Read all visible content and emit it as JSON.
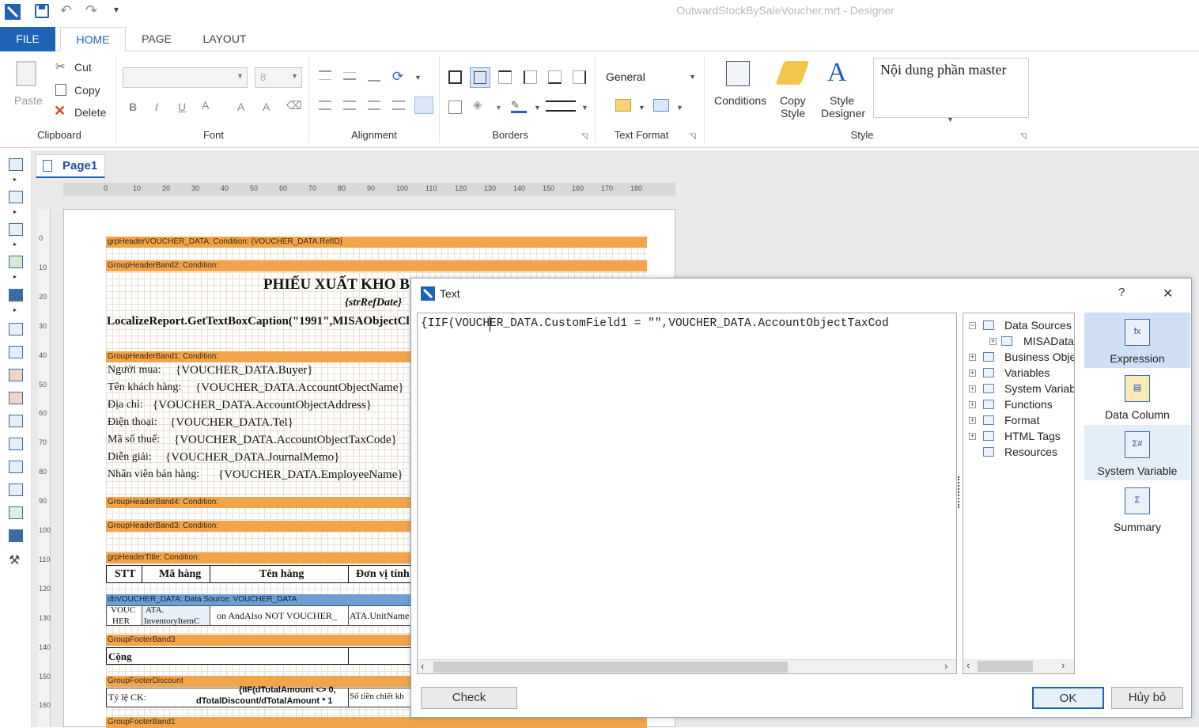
{
  "window": {
    "title": "OutwardStockBySaleVoucher.mrt  - Designer"
  },
  "quick_access": {
    "save": "save-icon",
    "undo": "undo-icon",
    "redo": "redo-icon",
    "customize": "▾"
  },
  "ribbon_tabs": [
    "FILE",
    "HOME",
    "PAGE",
    "LAYOUT"
  ],
  "clipboard": {
    "paste": "Paste",
    "cut": "Cut",
    "copy": "Copy",
    "delete": "Delete",
    "label": "Clipboard"
  },
  "font": {
    "name": "",
    "size": "8",
    "bold": "B",
    "italic": "I",
    "underline": "U",
    "color": "A",
    "grow": "A",
    "shrink": "A",
    "label": "Font"
  },
  "alignment": {
    "label": "Alignment"
  },
  "borders": {
    "label": "Borders"
  },
  "text_format": {
    "value": "General",
    "label": "Text Format"
  },
  "style": {
    "conditions": "Conditions",
    "copy_style": [
      "Copy",
      "Style"
    ],
    "designer": [
      "Style",
      "Designer"
    ],
    "preview": "Nội dung phần master",
    "label": "Style"
  },
  "designer": {
    "page_tab": "Page1",
    "ruler_h": [
      "0",
      "10",
      "20",
      "30",
      "40",
      "50",
      "60",
      "70",
      "80",
      "90",
      "100",
      "110",
      "120",
      "130",
      "140",
      "150",
      "160",
      "170",
      "180"
    ],
    "ruler_v": [
      "0",
      "10",
      "20",
      "30",
      "40",
      "50",
      "60",
      "70",
      "80",
      "90",
      "100",
      "110",
      "120",
      "130",
      "140",
      "150",
      "160"
    ]
  },
  "report": {
    "bands": [
      "grpHeaderVOUCHER_DATA: Condition: {VOUCHER_DATA.RefID}",
      "GroupHeaderBand2: Condition:",
      "GroupHeaderBand1: Condition:",
      "GroupHeaderBand4: Condition:",
      "GroupHeaderBand3: Condition:",
      "grpHeaderTitle: Condition:",
      "dbVOUCHER_DATA: Data Source: VOUCHER_DATA",
      "GroupFooterBand3",
      "GroupFooterDiscount",
      "GroupFooterBand1"
    ],
    "title": "PHIẾU XUẤT KHO B",
    "date_expr": "{strRefDate}",
    "caption_expr": "LocalizeReport.GetTextBoxCaption(\"1991\",MISAObjectCl",
    "fields": [
      {
        "label": "Người mua:",
        "value": "{VOUCHER_DATA.Buyer}"
      },
      {
        "label": "Tên khách hàng:",
        "value": "{VOUCHER_DATA.AccountObjectName}"
      },
      {
        "label": "Địa chỉ:",
        "value": "{VOUCHER_DATA.AccountObjectAddress}"
      },
      {
        "label": "Điện thoại:",
        "value": "{VOUCHER_DATA.Tel}"
      },
      {
        "label": "Mã số thuế:",
        "value": "{VOUCHER_DATA.AccountObjectTaxCode}"
      },
      {
        "label": "Diễn giải:",
        "value": "{VOUCHER_DATA.JournalMemo}"
      },
      {
        "label": "Nhân viên bán hàng:",
        "value": "{VOUCHER_DATA.EmployeeName}"
      }
    ],
    "table_headers": [
      "STT",
      "Mã hàng",
      "Tên hàng",
      "Đơn vị tính"
    ],
    "data_cells": [
      "VOUC",
      "HER",
      "ATA.",
      "InventoryItemC",
      "on AndAlso NOT VOUCHER_",
      "ATA.UnitName"
    ],
    "footer_total": "Cộng",
    "discount_label": "Tỷ lệ CK:",
    "discount_expr": "{IIF(dTotalAmount <> 0,",
    "discount_expr2": "dTotalDiscount/dTotalAmount * 1",
    "discount_amount_label": "Số tiền chiết kh"
  },
  "dialog": {
    "title": "Text",
    "help": "?",
    "close": "✕",
    "expression": "{IIF(VOUCHER_DATA.CustomField1 = \"\",VOUCHER_DATA.AccountObjectTaxCod",
    "tree": [
      {
        "label": "Data Sources",
        "expander": "−",
        "icon": "data-sources-icon"
      },
      {
        "label": "MISAData",
        "expander": "+",
        "icon": "database-icon"
      },
      {
        "label": "Business Objec",
        "expander": "+",
        "icon": "business-objects-icon"
      },
      {
        "label": "Variables",
        "expander": "+",
        "icon": "variables-icon"
      },
      {
        "label": "System Variabl",
        "expander": "+",
        "icon": "system-variables-icon"
      },
      {
        "label": "Functions",
        "expander": "+",
        "icon": "functions-icon"
      },
      {
        "label": "Format",
        "expander": "+",
        "icon": "format-icon"
      },
      {
        "label": "HTML Tags",
        "expander": "+",
        "icon": "html-tags-icon"
      },
      {
        "label": "Resources",
        "expander": "",
        "icon": "resources-icon"
      }
    ],
    "side_buttons": [
      "Expression",
      "Data Column",
      "System Variable",
      "Summary"
    ],
    "check": "Check",
    "ok": "OK",
    "cancel": "Hủy bỏ"
  },
  "colors": {
    "accent": "#1e63b6",
    "band_orange": "#f2a44a",
    "band_blue": "#6f9fd2",
    "side_selected": "#cfe0f5"
  }
}
